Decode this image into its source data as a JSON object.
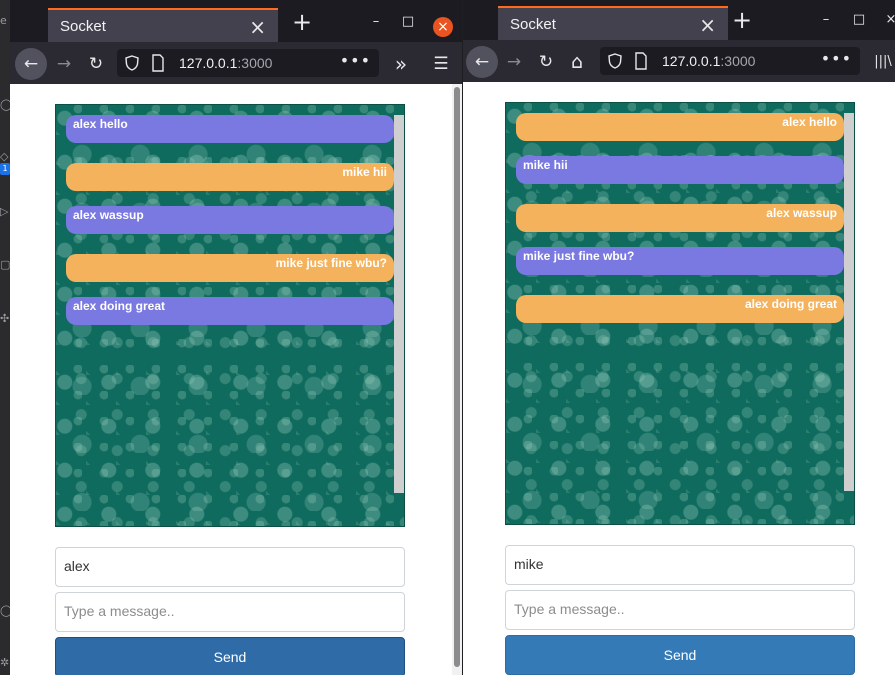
{
  "colors": {
    "purple_bubble": "#7a79e1",
    "orange_bubble": "#f4b25d",
    "chat_background": "#0f6b5e",
    "send_button": "#337ab7",
    "tab_accent": "#ff6a1f",
    "close_button": "#e95420"
  },
  "icons": {
    "back": "←",
    "forward": "→",
    "reload": "↻",
    "home": "⌂",
    "more_dots": "•••",
    "overflow": "»",
    "menu": "☰",
    "library": "|||\\",
    "new_tab": "+",
    "tab_close": "×",
    "minimize": "–",
    "maximize": "□",
    "window_close": "×"
  },
  "sidebar": {
    "badge": "1",
    "icons": [
      "e",
      "◯",
      "◇",
      "▷",
      "▢",
      "✣",
      "◯",
      "✲"
    ]
  },
  "window_left": {
    "tab_title": "Socket",
    "url_host": "127.0.0.1",
    "url_port": ":3000",
    "chat": {
      "messages": [
        {
          "text": "alex hello",
          "side": "purple"
        },
        {
          "text": "mike hii",
          "side": "orange"
        },
        {
          "text": "alex wassup",
          "side": "purple"
        },
        {
          "text": "mike just fine wbu?",
          "side": "orange"
        },
        {
          "text": "alex doing great",
          "side": "purple"
        }
      ]
    },
    "name_value": "alex",
    "message_placeholder": "Type a message..",
    "send_label": "Send"
  },
  "window_right": {
    "tab_title": "Socket",
    "url_host": "127.0.0.1",
    "url_port": ":3000",
    "chat": {
      "messages": [
        {
          "text": "alex hello",
          "side": "orange"
        },
        {
          "text": "mike hii",
          "side": "purple"
        },
        {
          "text": "alex wassup",
          "side": "orange"
        },
        {
          "text": "mike just fine wbu?",
          "side": "purple"
        },
        {
          "text": "alex doing great",
          "side": "orange"
        }
      ]
    },
    "name_value": "mike",
    "message_placeholder": "Type a message..",
    "send_label": "Send"
  }
}
